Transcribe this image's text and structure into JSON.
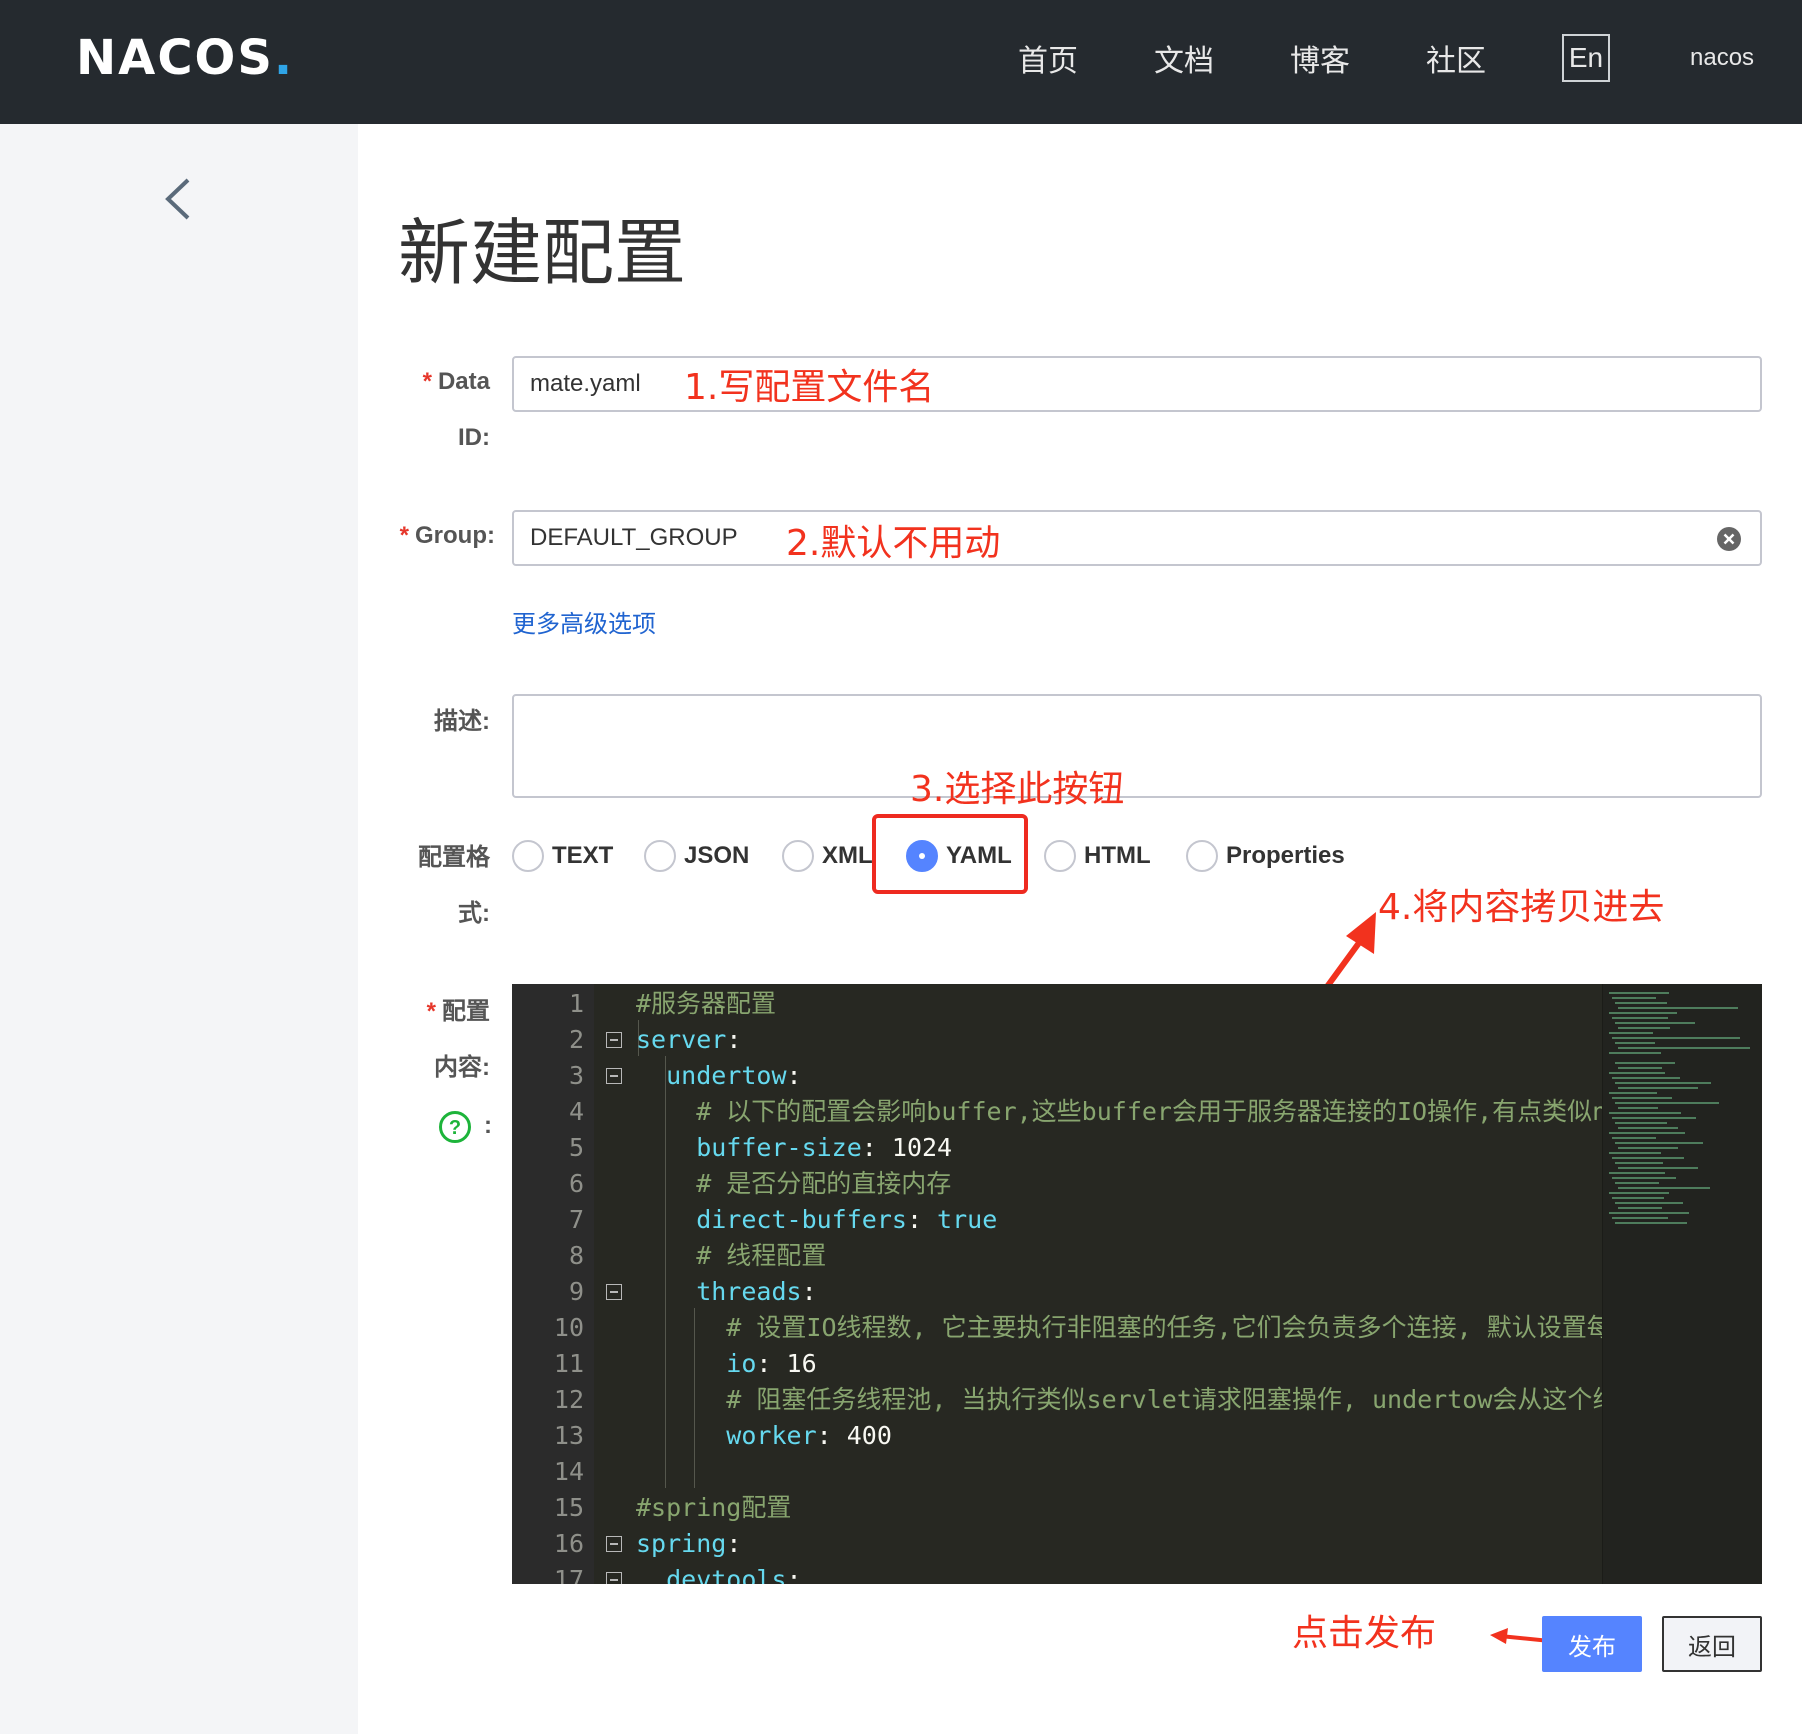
{
  "header": {
    "logo": "NACOS",
    "logo_dot": ".",
    "nav": [
      "首页",
      "文档",
      "博客",
      "社区"
    ],
    "lang_button": "En",
    "user": "nacos"
  },
  "page": {
    "title": "新建配置"
  },
  "form": {
    "data_id": {
      "label_line1": "Data",
      "label_line2": "ID:",
      "value": "mate.yaml"
    },
    "group": {
      "label": "Group:",
      "value": "DEFAULT_GROUP"
    },
    "advanced_link": "更多高级选项",
    "description": {
      "label": "描述:",
      "value": ""
    },
    "format": {
      "label_line1": "配置格",
      "label_line2": "式:",
      "options": [
        "TEXT",
        "JSON",
        "XML",
        "YAML",
        "HTML",
        "Properties"
      ],
      "selected": "YAML"
    },
    "content": {
      "label_line1": "配置",
      "label_line2": "内容:",
      "help_suffix": ":"
    }
  },
  "annotations": {
    "step1": "1.写配置文件名",
    "step2": "2.默认不用动",
    "step3": "3.选择此按钮",
    "step4": "4.将内容拷贝进去",
    "step5": "点击发布"
  },
  "editor": {
    "lines": [
      {
        "n": "1",
        "segments": [
          {
            "t": "#服务器配置",
            "c": "comment"
          }
        ]
      },
      {
        "n": "2",
        "segments": [
          {
            "t": "server",
            "c": "key"
          },
          {
            "t": ":",
            "c": "punc"
          }
        ]
      },
      {
        "n": "3",
        "segments": [
          {
            "t": "  undertow",
            "c": "key"
          },
          {
            "t": ":",
            "c": "punc"
          }
        ]
      },
      {
        "n": "4",
        "segments": [
          {
            "t": "    # 以下的配置会影响buffer,这些buffer会用于服务器连接的IO操作,有点类似net",
            "c": "comment"
          }
        ]
      },
      {
        "n": "5",
        "segments": [
          {
            "t": "    buffer-size",
            "c": "key"
          },
          {
            "t": ": ",
            "c": "punc"
          },
          {
            "t": "1024",
            "c": "num"
          }
        ]
      },
      {
        "n": "6",
        "segments": [
          {
            "t": "    # 是否分配的直接内存",
            "c": "comment"
          }
        ]
      },
      {
        "n": "7",
        "segments": [
          {
            "t": "    direct-buffers",
            "c": "key"
          },
          {
            "t": ": ",
            "c": "punc"
          },
          {
            "t": "true",
            "c": "bool"
          }
        ]
      },
      {
        "n": "8",
        "segments": [
          {
            "t": "    # 线程配置",
            "c": "comment"
          }
        ]
      },
      {
        "n": "9",
        "segments": [
          {
            "t": "    threads",
            "c": "key"
          },
          {
            "t": ":",
            "c": "punc"
          }
        ]
      },
      {
        "n": "10",
        "segments": [
          {
            "t": "      # 设置IO线程数, 它主要执行非阻塞的任务,它们会负责多个连接, 默认设置每个(",
            "c": "comment"
          }
        ]
      },
      {
        "n": "11",
        "segments": [
          {
            "t": "      io",
            "c": "key"
          },
          {
            "t": ": ",
            "c": "punc"
          },
          {
            "t": "16",
            "c": "num"
          }
        ]
      },
      {
        "n": "12",
        "segments": [
          {
            "t": "      # 阻塞任务线程池, 当执行类似servlet请求阻塞操作, undertow会从这个线程",
            "c": "comment"
          }
        ]
      },
      {
        "n": "13",
        "segments": [
          {
            "t": "      worker",
            "c": "key"
          },
          {
            "t": ": ",
            "c": "punc"
          },
          {
            "t": "400",
            "c": "num"
          }
        ]
      },
      {
        "n": "14",
        "segments": []
      },
      {
        "n": "15",
        "segments": [
          {
            "t": "#spring配置",
            "c": "comment"
          }
        ]
      },
      {
        "n": "16",
        "segments": [
          {
            "t": "spring",
            "c": "key"
          },
          {
            "t": ":",
            "c": "punc"
          }
        ]
      },
      {
        "n": "17",
        "segments": [
          {
            "t": "  devtools",
            "c": "key"
          },
          {
            "t": ":",
            "c": "punc"
          }
        ]
      }
    ],
    "folds": [
      "2",
      "3",
      "9",
      "16",
      "17"
    ]
  },
  "buttons": {
    "publish": "发布",
    "back": "返回"
  },
  "colors": {
    "topbar": "#252a2f",
    "sidebar": "#f4f5f7",
    "primary": "#5584ff",
    "annotation": "#f2321e",
    "editor_bg": "#272822"
  }
}
